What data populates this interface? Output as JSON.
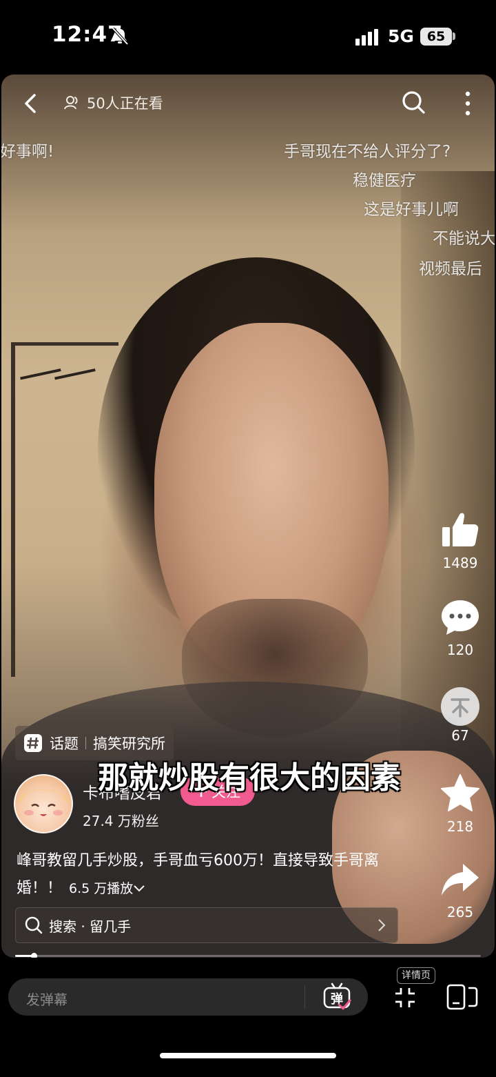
{
  "status_bar": {
    "time": "12:47",
    "network": "5G",
    "battery": "65"
  },
  "video": {
    "viewers": "50人正在看",
    "danmaku": [
      "好事啊!",
      "手哥现在不给人评分了?",
      "稳健医疗",
      "这是好事儿啊",
      "不能说大",
      "视频最后"
    ],
    "subtitle": "那就炒股有很大的因素",
    "topic": {
      "label": "话题",
      "name": "搞笑研究所"
    },
    "author": {
      "name": "卡布嗜皮君",
      "followers": "27.4 万粉丝",
      "follow_label": "关注"
    },
    "caption": "峰哥教留几手炒股，手哥血亏600万！直接导致手哥离婚！！",
    "plays": "6.5 万播放",
    "search": "搜索 · 留几手",
    "progress": 0.04
  },
  "actions": {
    "likes": "1489",
    "comments": "120",
    "coins": "67",
    "favorites": "218",
    "shares": "265"
  },
  "bottom_bar": {
    "danmu_placeholder": "发弹幕",
    "danmu_button": "弹",
    "detail_label": "详情页"
  }
}
